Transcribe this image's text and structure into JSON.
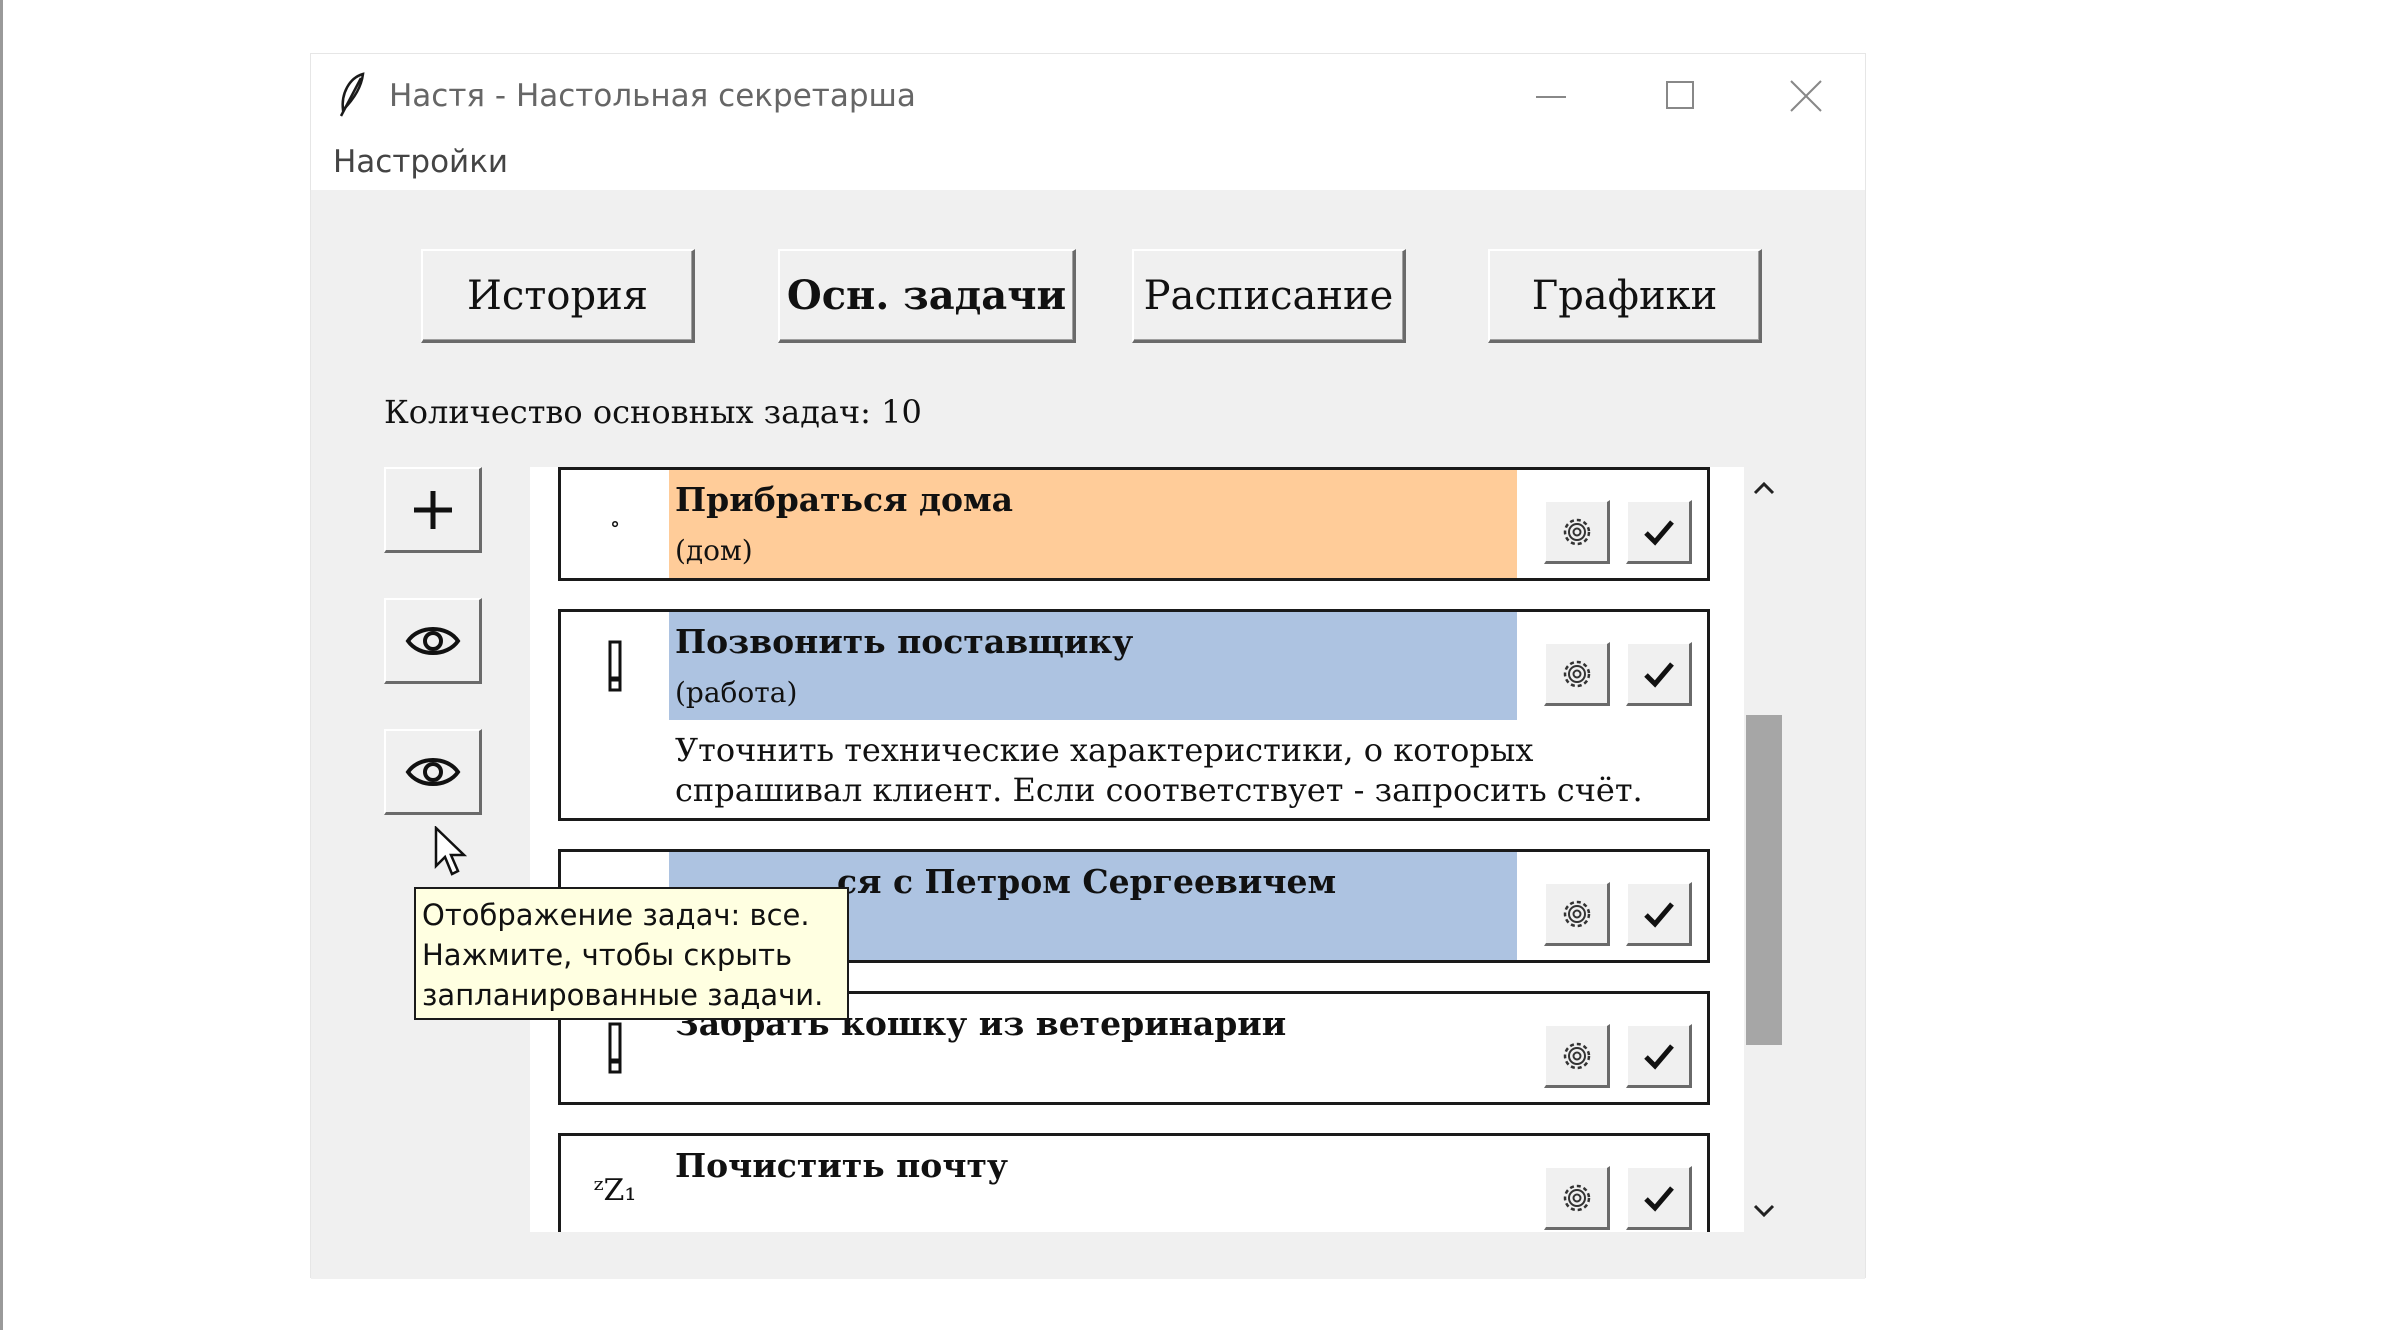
{
  "window": {
    "title": "Настя - Настольная секретарша",
    "icon": "feather-icon"
  },
  "menu": {
    "settings": "Настройки"
  },
  "tabs": [
    {
      "label": "История",
      "active": false
    },
    {
      "label": "Осн. задачи",
      "active": true
    },
    {
      "label": "Расписание",
      "active": false
    },
    {
      "label": "Графики",
      "active": false
    }
  ],
  "task_count_label": "Количество основных задач: 10",
  "side_buttons": {
    "add": "+"
  },
  "tasks": [
    {
      "priority_icon": "small-circle-icon",
      "priority_glyph": "∘",
      "title": "Прибраться дома",
      "category": "(дом)",
      "description": "",
      "highlight": "#ffcc99"
    },
    {
      "priority_icon": "exclamation-icon",
      "priority_glyph": "!",
      "title": "Позвонить поставщику",
      "category": "(работа)",
      "description": "Уточнить технические характеристики, о которых спрашивал клиент. Если соответствует - запросить счёт.",
      "highlight": "#adc3e1"
    },
    {
      "priority_icon": "hidden",
      "priority_glyph": "",
      "title": "ся с Петром Сергеевичем",
      "category": "",
      "description": "",
      "highlight": "#adc3e1"
    },
    {
      "priority_icon": "exclamation-icon",
      "priority_glyph": "!",
      "title": "Забрать кошку из ветеринарии",
      "category": "",
      "description": "",
      "highlight": ""
    },
    {
      "priority_icon": "sleep-zz-icon",
      "priority_glyph": "ᶻZ₁",
      "title": "Почистить почту",
      "category": "",
      "description": "",
      "highlight": ""
    }
  ],
  "tooltip": {
    "line1": "Отображение задач: все.",
    "line2": "Нажмите, чтобы скрыть",
    "line3": "запланированные задачи."
  },
  "colors": {
    "orange_highlight": "#ffcc99",
    "blue_highlight": "#adc3e1",
    "tooltip_bg": "#ffffe1",
    "panel_bg": "#f0f0f0"
  }
}
